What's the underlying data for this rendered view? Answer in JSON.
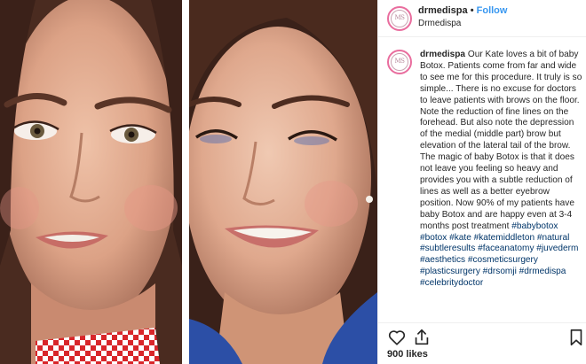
{
  "post": {
    "images": [
      {
        "name": "before-photo",
        "description_icon": "face-closeup-photo"
      },
      {
        "name": "after-photo",
        "description_icon": "smiling-face-photo"
      }
    ],
    "header": {
      "username": "drmedispa",
      "separator": "•",
      "follow_label": "Follow",
      "subtitle": "Drmedispa",
      "avatar_monogram": "MS"
    },
    "caption": {
      "username": "drmedispa",
      "body": "Our Kate loves a bit of baby Botox. Patients come from far and wide to see me for this procedure. It truly is so simple... There is no excuse for doctors to leave patients with brows on the floor. Note the reduction of fine lines on the forehead. But also note the depression of the medial (middle part) brow but elevation of the lateral tail of the brow. The magic of baby Botox is that it does not leave you feeling so heavy and provides you with a subtle reduction of lines as well as a better eyebrow position.  Now 90% of my patients have baby Botox and are happy even at 3-4 months post treatment",
      "hashtags": "#babybotox #botox #kate #katemiddleton #natural #subtleresults #faceanatomy #juvederm #aesthetics #cosmeticsurgery #plasticsurgery #drsomji #drmedispa #celebritydoctor"
    },
    "actions": {
      "like_icon": "heart-icon",
      "share_icon": "share-icon",
      "save_icon": "bookmark-icon"
    },
    "likes": "900 likes",
    "colors": {
      "follow": "#3897f0",
      "hashtag": "#003569",
      "avatar_ring": "#e96d9e"
    }
  }
}
